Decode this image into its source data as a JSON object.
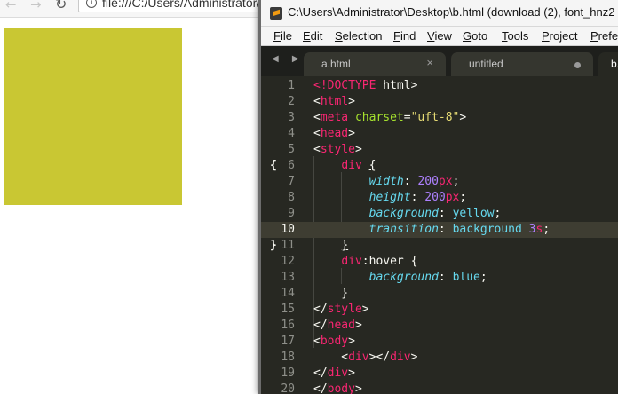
{
  "browser": {
    "back_icon": "arrow-left-icon",
    "forward_icon": "arrow-right-icon",
    "reload_icon": "reload-icon",
    "url": "file:///C:/Users/Administrator/Desktop/b.html",
    "demo_color": "#c9c733"
  },
  "editor": {
    "title": "C:\\Users\\Administrator\\Desktop\\b.html (download (2), font_hnz2",
    "menu": [
      "File",
      "Edit",
      "Selection",
      "Find",
      "View",
      "Goto",
      "Tools",
      "Project",
      "Prefer"
    ],
    "tabs": [
      {
        "label": "a.html",
        "state": "close"
      },
      {
        "label": "untitled",
        "state": "dirty"
      },
      {
        "label": "b.",
        "state": "active"
      }
    ],
    "current_line": 10,
    "fold_open": "{",
    "fold_close": "}",
    "lines": [
      {
        "n": "1",
        "tokens": [
          [
            "tag",
            "<!"
          ],
          [
            "tag",
            "DOCTYPE"
          ],
          [
            "plain",
            " html>"
          ]
        ]
      },
      {
        "n": "2",
        "tokens": [
          [
            "plain",
            "<"
          ],
          [
            "tag",
            "html"
          ],
          [
            "plain",
            ">"
          ]
        ]
      },
      {
        "n": "3",
        "tokens": [
          [
            "plain",
            "<"
          ],
          [
            "tag",
            "meta"
          ],
          [
            "plain",
            " "
          ],
          [
            "attr",
            "charset"
          ],
          [
            "plain",
            "="
          ],
          [
            "str",
            "\"uft-8\""
          ],
          [
            "plain",
            ">"
          ]
        ]
      },
      {
        "n": "4",
        "tokens": [
          [
            "plain",
            "<"
          ],
          [
            "tag",
            "head"
          ],
          [
            "plain",
            ">"
          ]
        ]
      },
      {
        "n": "5",
        "tokens": [
          [
            "plain",
            "<"
          ],
          [
            "tag",
            "style"
          ],
          [
            "plain",
            ">"
          ]
        ]
      },
      {
        "n": "6",
        "tokens": [
          [
            "plain",
            "    "
          ],
          [
            "sel",
            "div"
          ],
          [
            "plain",
            " "
          ],
          [
            "brace",
            "{"
          ]
        ]
      },
      {
        "n": "7",
        "tokens": [
          [
            "plain",
            "        "
          ],
          [
            "prop",
            "width"
          ],
          [
            "plain",
            ": "
          ],
          [
            "num",
            "200"
          ],
          [
            "unit",
            "px"
          ],
          [
            "plain",
            ";"
          ]
        ]
      },
      {
        "n": "8",
        "tokens": [
          [
            "plain",
            "        "
          ],
          [
            "prop",
            "height"
          ],
          [
            "plain",
            ": "
          ],
          [
            "num",
            "200"
          ],
          [
            "unit",
            "px"
          ],
          [
            "plain",
            ";"
          ]
        ]
      },
      {
        "n": "9",
        "tokens": [
          [
            "plain",
            "        "
          ],
          [
            "prop",
            "background"
          ],
          [
            "plain",
            ": "
          ],
          [
            "val",
            "yellow"
          ],
          [
            "plain",
            ";"
          ]
        ]
      },
      {
        "n": "10",
        "tokens": [
          [
            "plain",
            "        "
          ],
          [
            "prop",
            "transition"
          ],
          [
            "plain",
            ": "
          ],
          [
            "val",
            "background"
          ],
          [
            "plain",
            " "
          ],
          [
            "num",
            "3"
          ],
          [
            "unit",
            "s"
          ],
          [
            "plain",
            ";"
          ]
        ]
      },
      {
        "n": "11",
        "tokens": [
          [
            "plain",
            "    "
          ],
          [
            "brace",
            "}"
          ]
        ]
      },
      {
        "n": "12",
        "tokens": [
          [
            "plain",
            "    "
          ],
          [
            "sel",
            "div"
          ],
          [
            "plain",
            ":hover {"
          ]
        ]
      },
      {
        "n": "13",
        "tokens": [
          [
            "plain",
            "        "
          ],
          [
            "prop",
            "background"
          ],
          [
            "plain",
            ": "
          ],
          [
            "val",
            "blue"
          ],
          [
            "plain",
            ";"
          ]
        ]
      },
      {
        "n": "14",
        "tokens": [
          [
            "plain",
            "    }"
          ]
        ]
      },
      {
        "n": "15",
        "tokens": [
          [
            "plain",
            "</"
          ],
          [
            "tag",
            "style"
          ],
          [
            "plain",
            ">"
          ]
        ]
      },
      {
        "n": "16",
        "tokens": [
          [
            "plain",
            "</"
          ],
          [
            "tag",
            "head"
          ],
          [
            "plain",
            ">"
          ]
        ]
      },
      {
        "n": "17",
        "tokens": [
          [
            "plain",
            "<"
          ],
          [
            "tag",
            "body"
          ],
          [
            "plain",
            ">"
          ]
        ]
      },
      {
        "n": "18",
        "tokens": [
          [
            "plain",
            "    <"
          ],
          [
            "tag",
            "div"
          ],
          [
            "plain",
            "></"
          ],
          [
            "tag",
            "div"
          ],
          [
            "plain",
            ">"
          ]
        ]
      },
      {
        "n": "19",
        "tokens": [
          [
            "plain",
            "</"
          ],
          [
            "tag",
            "div"
          ],
          [
            "plain",
            ">"
          ]
        ]
      },
      {
        "n": "20",
        "tokens": [
          [
            "plain",
            "</"
          ],
          [
            "tag",
            "body"
          ],
          [
            "plain",
            ">"
          ]
        ]
      }
    ]
  }
}
